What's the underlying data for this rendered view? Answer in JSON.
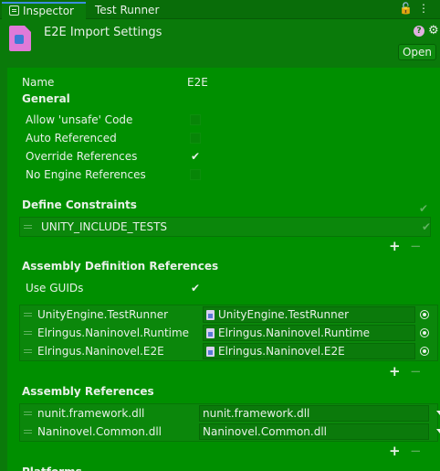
{
  "tabs": {
    "inspector": "Inspector",
    "test_runner": "Test Runner"
  },
  "tab_tools": {
    "lock": "🔓",
    "menu": "⋮"
  },
  "header": {
    "title": "E2E Import Settings",
    "help": "?",
    "gear": "⚙",
    "open_label": "Open"
  },
  "name_field": {
    "label": "Name",
    "value": "E2E"
  },
  "general": {
    "heading": "General",
    "options": [
      {
        "label": "Allow 'unsafe' Code",
        "checked": false
      },
      {
        "label": "Auto Referenced",
        "checked": false
      },
      {
        "label": "Override References",
        "checked": true
      },
      {
        "label": "No Engine References",
        "checked": false
      }
    ]
  },
  "define_constraints": {
    "heading": "Define Constraints",
    "items": [
      "UNITY_INCLUDE_TESTS"
    ]
  },
  "asmdef_refs": {
    "heading": "Assembly Definition References",
    "use_guids_label": "Use GUIDs",
    "use_guids_checked": true,
    "items": [
      {
        "name": "UnityEngine.TestRunner",
        "value": "UnityEngine.TestRunner"
      },
      {
        "name": "Elringus.Naninovel.Runtime",
        "value": "Elringus.Naninovel.Runtime"
      },
      {
        "name": "Elringus.Naninovel.E2E",
        "value": "Elringus.Naninovel.E2E"
      }
    ]
  },
  "assembly_refs": {
    "heading": "Assembly References",
    "items": [
      {
        "name": "nunit.framework.dll",
        "value": "nunit.framework.dll"
      },
      {
        "name": "Naninovel.Common.dll",
        "value": "Naninovel.Common.dll"
      }
    ]
  },
  "platforms": {
    "heading": "Platforms"
  },
  "list_controls": {
    "add": "+",
    "remove": "−"
  },
  "checkmark": "✔"
}
